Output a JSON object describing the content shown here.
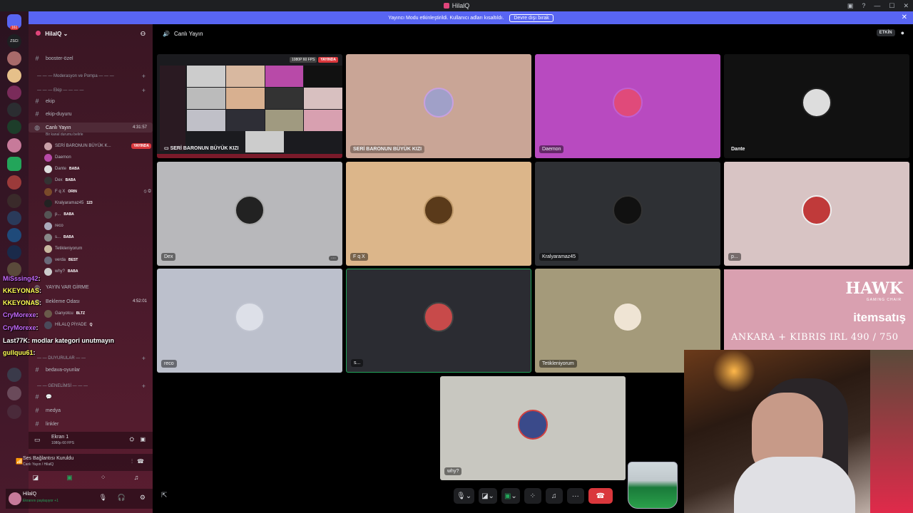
{
  "titlebar": {
    "title": "HilalQ"
  },
  "banner": {
    "text": "Yayıncı Modu etkinleştirildi. Kullanıcı adları kısaltıldı.",
    "button": "Devre dışı bırak"
  },
  "server": {
    "name": "HilalQ"
  },
  "rail": {
    "labels": [
      "ZSCI"
    ],
    "badge": "161"
  },
  "channels": {
    "booster": "booster-özel",
    "cat_moderasyon": "— — — Moderasyon ve Pompa — — —",
    "cat_ekip": "— — — Ekip — — — —",
    "ekip": "ekip",
    "ekip_duyuru": "ekip-duyuru",
    "canli_yayin": "Canlı Yayın",
    "canli_status": "Bir kanal durumu belirle",
    "canli_time": "4:31:57",
    "yayin_var": "YAYIN VAR GİRME",
    "bekleme": "Bekleme Odası",
    "bekleme_time": "4:52:01",
    "cat_duyurular": "— — DUYURULAR — —",
    "bedava": "bedava-oyunlar",
    "cat_genel": "— — GENELİMSİ — — —",
    "medya": "medya",
    "linkler": "linkler"
  },
  "voice_users": [
    {
      "name": "SERİ BARONUN BÜYÜK K...",
      "badge": "YAYINDA"
    },
    {
      "name": "Daemon",
      "badge": ""
    },
    {
      "name": "Dante",
      "badge": "BABA"
    },
    {
      "name": "Dex",
      "badge": "BABA"
    },
    {
      "name": "F q X",
      "badge": "ORIN"
    },
    {
      "name": "Kralyaramaz45",
      "badge": "123"
    },
    {
      "name": "p...",
      "badge": "BABA"
    },
    {
      "name": "reco",
      "badge": ""
    },
    {
      "name": "s...",
      "badge": "BABA"
    },
    {
      "name": "Tetikleniyorum",
      "badge": ""
    },
    {
      "name": "verda",
      "badge": "BEST"
    },
    {
      "name": "why?",
      "badge": "BABA"
    }
  ],
  "bekleme_users": [
    {
      "name": "Ganyotcu",
      "badge": "BLTZ"
    },
    {
      "name": "HİLALQ PİYADE",
      "badge": "Q"
    }
  ],
  "chat": [
    {
      "user": "MiSssing42",
      "msg": ":",
      "color": "#c86bff"
    },
    {
      "user": "KKEYONAS",
      "msg": ":",
      "color": "#ffff55"
    },
    {
      "user": "KKEYONAS",
      "msg": ":",
      "color": "#ffff55"
    },
    {
      "user": "CryMorexe",
      "msg": ":",
      "color": "#c86bff"
    },
    {
      "user": "CryMorexe",
      "msg": ":",
      "color": "#c86bff"
    },
    {
      "user": "Last77K",
      "msg": ": modlar kategori unutmayın",
      "color": "#ffffff"
    },
    {
      "user": "gullquu61",
      "msg": ":",
      "color": "#ffff55"
    }
  ],
  "screen_panel": {
    "title": "Ekran 1",
    "sub": "1080p 60 FPS"
  },
  "voice_panel": {
    "title": "Ses Bağlantısı Kuruldu",
    "sub": "Canlı Yayın / HilalQ"
  },
  "user_panel": {
    "name": "HilalQ",
    "status": "Ekranını paylaşıyor +1"
  },
  "header": {
    "channel": "Canlı Yayın",
    "activity": "ETKİN"
  },
  "tiles": [
    {
      "name": "SERİ BARONUN BÜYÜK KIZI",
      "stream_res": "1080P 60 FPS",
      "live": "YAYINDA"
    },
    {
      "name": "SERİ BARONUN BÜYÜK KIZI"
    },
    {
      "name": "Daemon"
    },
    {
      "name": "Dante"
    },
    {
      "name": "Dex"
    },
    {
      "name": "F q X"
    },
    {
      "name": "Kralyaramaz45"
    },
    {
      "name": "p..."
    },
    {
      "name": "reco"
    },
    {
      "name": "s..."
    },
    {
      "name": "Tetikleniyorum"
    },
    {
      "name": "why?"
    }
  ],
  "sponsor": {
    "brand": "HAWK",
    "brand_sub": "GAMING CHAIR",
    "shop": "itemsatış",
    "promo": "ANKARA + KIBRIS IRL 490 / 750"
  },
  "colors": {
    "brand": "#5865f2",
    "live": "#da373c",
    "speaking": "#23a55a"
  }
}
